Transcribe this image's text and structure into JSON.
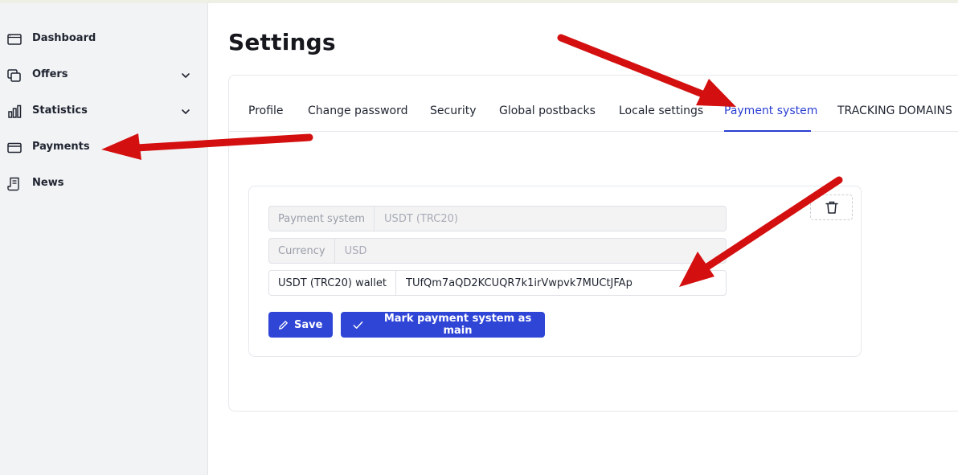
{
  "sidebar": {
    "items": [
      {
        "label": "Dashboard",
        "icon": "monitor-icon",
        "has_chevron": false
      },
      {
        "label": "Offers",
        "icon": "layers-icon",
        "has_chevron": true
      },
      {
        "label": "Statistics",
        "icon": "bar-chart-icon",
        "has_chevron": true
      },
      {
        "label": "Payments",
        "icon": "card-icon",
        "has_chevron": false
      },
      {
        "label": "News",
        "icon": "document-icon",
        "has_chevron": false
      }
    ]
  },
  "page": {
    "title": "Settings"
  },
  "tabs": [
    {
      "label": "Profile",
      "active": false
    },
    {
      "label": "Change password",
      "active": false
    },
    {
      "label": "Security",
      "active": false
    },
    {
      "label": "Global postbacks",
      "active": false
    },
    {
      "label": "Locale settings",
      "active": false
    },
    {
      "label": "Payment system",
      "active": true
    },
    {
      "label": "TRACKING DOMAINS",
      "active": false
    }
  ],
  "payment_form": {
    "payment_system": {
      "label": "Payment system",
      "value": "USDT (TRC20)"
    },
    "currency": {
      "label": "Currency",
      "value": "USD"
    },
    "wallet": {
      "label": "USDT (TRC20) wallet",
      "value": "TUfQm7aQD2KCUQR7k1irVwpvk7MUCtJFAp"
    },
    "save_label": "Save",
    "mark_main_label": "Mark payment system as main"
  },
  "colors": {
    "accent": "#2f45d6",
    "active_tab": "#2b3fd1",
    "annotation_arrow": "#d40f0f",
    "sidebar_bg": "#f2f3f5"
  },
  "icons": {
    "delete": "trash-icon",
    "save": "pencil-icon",
    "mark_main": "check-icon"
  }
}
